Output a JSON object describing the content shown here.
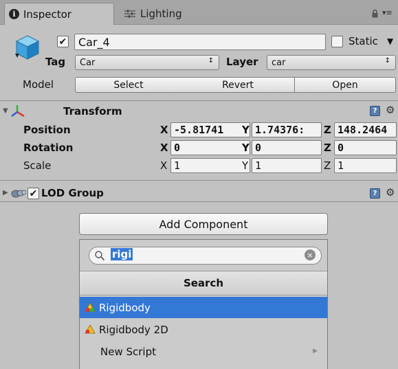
{
  "tabs": {
    "inspector": "Inspector",
    "lighting": "Lighting"
  },
  "object": {
    "name": "Car_4",
    "active": true,
    "static_label": "Static",
    "static": false,
    "tag_label": "Tag",
    "tag_value": "Car",
    "layer_label": "Layer",
    "layer_value": "car",
    "model_label": "Model",
    "model_buttons": {
      "select": "Select",
      "revert": "Revert",
      "open": "Open"
    }
  },
  "transform": {
    "title": "Transform",
    "rows": [
      {
        "label": "Position",
        "x": "-5.81741",
        "y": "1.74376:",
        "z": "148.2464"
      },
      {
        "label": "Rotation",
        "x": "0",
        "y": "0",
        "z": "0"
      },
      {
        "label": "Scale",
        "x": "1",
        "y": "1",
        "z": "1"
      }
    ],
    "axis_labels": {
      "x": "X",
      "y": "Y",
      "z": "Z"
    }
  },
  "lod_group": {
    "title": "LOD Group",
    "enabled": true
  },
  "add_component": {
    "button_label": "Add Component",
    "search_value": "rigi",
    "search_header": "Search",
    "results": [
      {
        "label": "Rigidbody",
        "icon": "rigidbody-icon",
        "selected": true
      },
      {
        "label": "Rigidbody 2D",
        "icon": "rigidbody2d-icon",
        "selected": false
      },
      {
        "label": "New Script",
        "icon": "",
        "selected": false,
        "has_submenu": true
      }
    ]
  },
  "colors": {
    "panel_bg": "#c2c2c2",
    "selection": "#3478d6"
  }
}
